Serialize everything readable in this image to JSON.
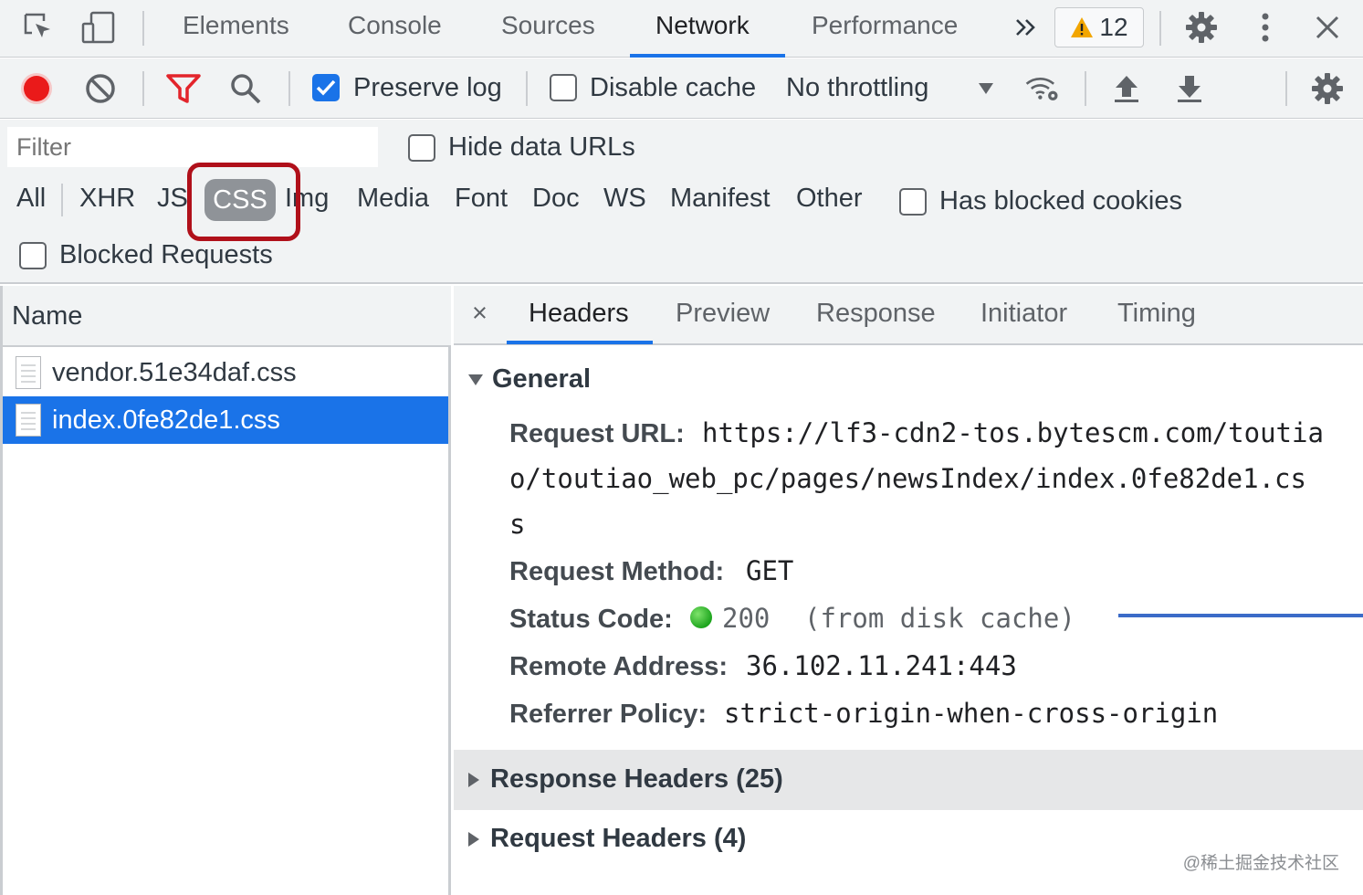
{
  "tabs": [
    "Elements",
    "Console",
    "Sources",
    "Network",
    "Performance"
  ],
  "active_tab": "Network",
  "warning_count": "12",
  "toolbar": {
    "preserve_log_label": "Preserve log",
    "preserve_log_checked": true,
    "disable_cache_label": "Disable cache",
    "disable_cache_checked": false,
    "throttling": "No throttling"
  },
  "filter": {
    "placeholder": "Filter",
    "hide_data_urls_label": "Hide data URLs",
    "types": [
      "All",
      "XHR",
      "JS",
      "CSS",
      "Img",
      "Media",
      "Font",
      "Doc",
      "WS",
      "Manifest",
      "Other"
    ],
    "active_type": "CSS",
    "has_blocked_cookies_label": "Has blocked cookies",
    "blocked_requests_label": "Blocked Requests"
  },
  "requests": {
    "column_header": "Name",
    "files": [
      "vendor.51e34daf.css",
      "index.0fe82de1.css"
    ],
    "selected": "index.0fe82de1.css"
  },
  "details": {
    "close_glyph": "×",
    "tabs": [
      "Headers",
      "Preview",
      "Response",
      "Initiator",
      "Timing"
    ],
    "active_tab": "Headers",
    "general_title": "General",
    "request_url_label": "Request URL:",
    "request_url_lines": [
      "https://lf3-cdn2-tos.bytescm.com/toutia",
      "o/toutiao_web_pc/pages/newsIndex/index.0fe82de1.cs",
      "s"
    ],
    "request_method_label": "Request Method:",
    "request_method": "GET",
    "status_code_label": "Status Code:",
    "status_code": "200",
    "status_note": "(from disk cache)",
    "remote_address_label": "Remote Address:",
    "remote_address": "36.102.11.241:443",
    "referrer_policy_label": "Referrer Policy:",
    "referrer_policy": "strict-origin-when-cross-origin",
    "response_headers_title": "Response Headers (25)",
    "request_headers_title": "Request Headers (4)"
  },
  "watermark": "@稀土掘金技术社区",
  "colors": {
    "accent": "#1a73e8",
    "record": "#ea1a1a",
    "highlight_box": "#b0101a",
    "status_ok": "#1ea51e"
  }
}
